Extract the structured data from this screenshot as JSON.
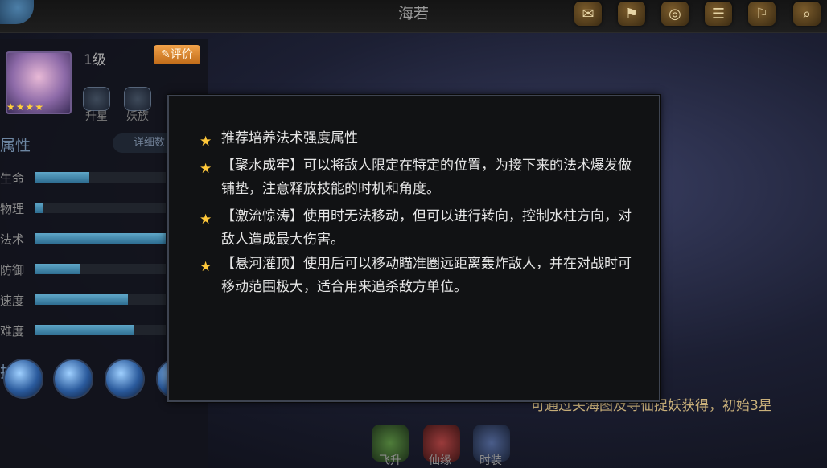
{
  "header": {
    "title": "海若"
  },
  "top_icons": [
    "scroll-icon",
    "map-icon",
    "coin-icon",
    "book-icon",
    "flag-icon",
    "search-icon"
  ],
  "hero": {
    "level": "1级",
    "rate_button": "评价",
    "stars": "★★★★"
  },
  "hero_buttons": [
    "升星",
    "妖族"
  ],
  "attributes_title": "属性",
  "details_button": "详细数",
  "attributes": [
    {
      "label": "生命",
      "value": 0.42
    },
    {
      "label": "物理",
      "value": 0.06
    },
    {
      "label": "法术",
      "value": 1.0
    },
    {
      "label": "防御",
      "value": 0.35
    },
    {
      "label": "速度",
      "value": 0.71
    },
    {
      "label": "难度",
      "value": 0.76
    }
  ],
  "skills_title": "技能",
  "bottom_tabs": [
    "飞升",
    "仙缘",
    "时装"
  ],
  "footer_note": "可通过关海图及寻仙捉妖获得，初始3星",
  "tips": [
    "推荐培养法术强度属性",
    "【聚水成牢】可以将敌人限定在特定的位置，为接下来的法术爆发做铺垫，注意释放技能的时机和角度。",
    "【激流惊涛】使用时无法移动，但可以进行转向，控制水柱方向，对敌人造成最大伤害。",
    "【悬河灌顶】使用后可以移动瞄准圈远距离轰炸敌人，并在对战时可移动范围极大，适合用来追杀敌方单位。"
  ],
  "colors": {
    "accent": "#ffc83a",
    "bar": "#3f86ab",
    "rate": "#e08a2e"
  }
}
